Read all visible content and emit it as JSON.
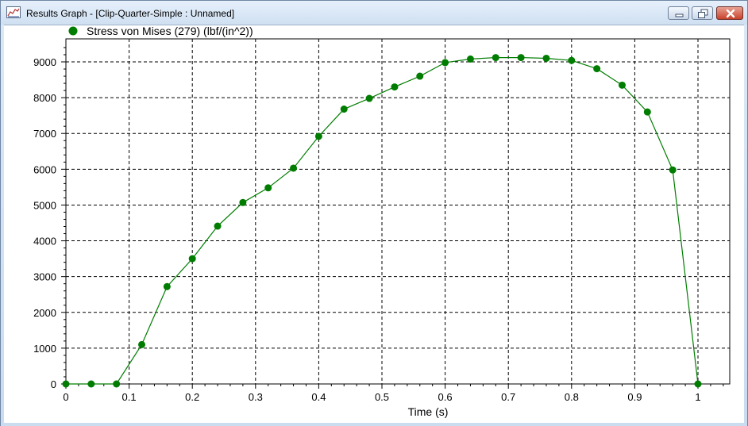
{
  "window": {
    "title": "Results Graph - [Clip-Quarter-Simple : Unnamed]",
    "icon": "graph-window-icon",
    "controls": [
      "minimize-icon",
      "restore-icon",
      "close-icon"
    ]
  },
  "chart_data": {
    "type": "line",
    "title": "",
    "xlabel": "Time (s)",
    "ylabel": "",
    "xlim": [
      0,
      1.05
    ],
    "ylim": [
      0,
      9500
    ],
    "xticks": [
      0,
      0.1,
      0.2,
      0.3,
      0.4,
      0.5,
      0.6,
      0.7,
      0.8,
      0.9,
      1
    ],
    "xtick_labels": [
      "0",
      "0.1",
      "0.2",
      "0.3",
      "0.4",
      "0.5",
      "0.6",
      "0.7",
      "0.8",
      "0.9",
      "1"
    ],
    "yticks": [
      0,
      1000,
      2000,
      3000,
      4000,
      5000,
      6000,
      7000,
      8000,
      9000
    ],
    "ytick_labels": [
      "0",
      "1000",
      "2000",
      "3000",
      "4000",
      "5000",
      "6000",
      "7000",
      "8000",
      "9000"
    ],
    "grid": true,
    "legend_position": "top-left",
    "series": [
      {
        "name": "Stress von Mises (279) (lbf/(in^2))",
        "color": "#007d00",
        "marker": "circle",
        "x": [
          0,
          0.04,
          0.08,
          0.12,
          0.16,
          0.2,
          0.24,
          0.28,
          0.32,
          0.36,
          0.4,
          0.44,
          0.48,
          0.52,
          0.56,
          0.6,
          0.64,
          0.68,
          0.72,
          0.76,
          0.8,
          0.84,
          0.88,
          0.92,
          0.96,
          1
        ],
        "y": [
          0,
          0,
          0,
          1100,
          2720,
          3500,
          4410,
          5070,
          5480,
          6030,
          6920,
          7680,
          7980,
          8300,
          8600,
          8980,
          9080,
          9120,
          9120,
          9100,
          9040,
          8810,
          8350,
          7600,
          5980,
          0
        ]
      }
    ]
  }
}
